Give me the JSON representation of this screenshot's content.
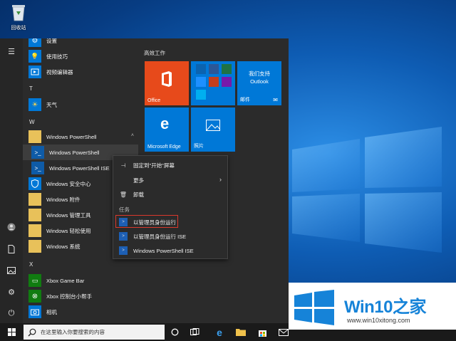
{
  "desktop": {
    "recycle_bin_label": "回收站"
  },
  "rail": {
    "items": [
      {
        "name": "hamburger-icon"
      },
      {
        "name": "user-icon"
      },
      {
        "name": "document-icon"
      },
      {
        "name": "pictures-icon"
      },
      {
        "name": "settings-icon"
      },
      {
        "name": "power-icon"
      }
    ]
  },
  "app_list": {
    "items": [
      {
        "label": "设置"
      },
      {
        "label": "使用技巧"
      },
      {
        "label": "视频编辑器"
      },
      {
        "letter": "T"
      },
      {
        "label": "天气"
      },
      {
        "letter": "W"
      },
      {
        "label": "Windows PowerShell"
      },
      {
        "label": "Windows PowerShell"
      },
      {
        "label": "Windows PowerShell ISE"
      },
      {
        "label": "Windows 安全中心"
      },
      {
        "label": "Windows 附件"
      },
      {
        "label": "Windows 管理工具"
      },
      {
        "label": "Windows 轻松使用"
      },
      {
        "label": "Windows 系统"
      },
      {
        "letter": "X"
      },
      {
        "label": "Xbox Game Bar"
      },
      {
        "label": "Xbox 控制台小帮手"
      },
      {
        "label": "相机"
      }
    ]
  },
  "tiles": {
    "group_title": "高效工作",
    "office_label": "Office",
    "mail_title": "我们支持",
    "mail_subtitle": "Outlook",
    "mail_label": "邮件",
    "edge_label": "Microsoft Edge",
    "photos_label": "照片"
  },
  "context_menu": {
    "pin_label": "固定到\"开始\"屏幕",
    "more_label": "更多",
    "uninstall_label": "卸载",
    "tasks_heading": "任务",
    "run_admin_label": "以管理员身份运行",
    "run_ise_admin_label": "以管理员身份运行 ISE",
    "ise_label": "Windows PowerShell ISE"
  },
  "taskbar": {
    "search_placeholder": "在这里输入你要搜索的内容"
  },
  "watermark": {
    "title_prefix": "Win10",
    "title_suffix": "之家",
    "url": "www.win10xitong.com"
  },
  "colors": {
    "tile_office": "#e74a1b",
    "tile_blue": "#0078d7",
    "accent": "#1683d8",
    "highlight_border": "#d9392c"
  }
}
